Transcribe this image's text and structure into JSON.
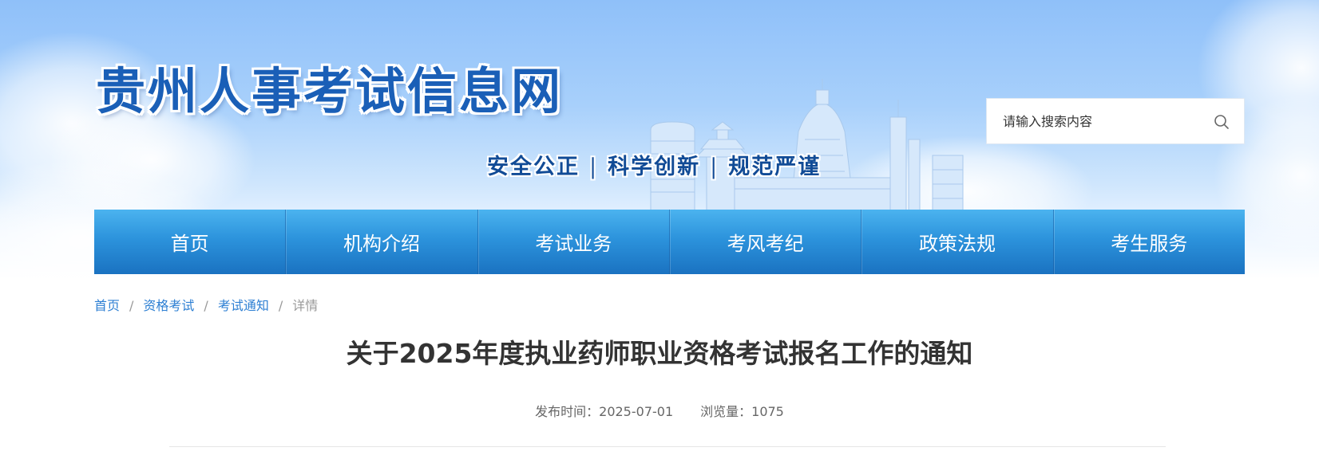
{
  "header": {
    "site_title": "贵州人事考试信息网",
    "slogan": {
      "part1": "安全公正",
      "part2": "科学创新",
      "part3": "规范严谨",
      "separator": "|"
    },
    "search": {
      "placeholder": "请输入搜索内容",
      "icon": "search-icon"
    },
    "colors": {
      "title": "#1a5fb7",
      "slogan": "#114b96",
      "nav_top": "#4bb3ef",
      "nav_bottom": "#1a72c1"
    }
  },
  "nav": {
    "items": [
      {
        "label": "首页"
      },
      {
        "label": "机构介绍"
      },
      {
        "label": "考试业务"
      },
      {
        "label": "考风考纪"
      },
      {
        "label": "政策法规"
      },
      {
        "label": "考生服务"
      }
    ]
  },
  "breadcrumb": {
    "items": [
      {
        "label": "首页"
      },
      {
        "label": "资格考试"
      },
      {
        "label": "考试通知"
      }
    ],
    "current": "详情",
    "separator": "/",
    "link_color": "#2d7fd3"
  },
  "article": {
    "title": "关于2025年度执业药师职业资格考试报名工作的通知",
    "publish_label": "发布时间：",
    "publish_date": "2025-07-01",
    "views_label": "浏览量：",
    "views": "1075"
  }
}
